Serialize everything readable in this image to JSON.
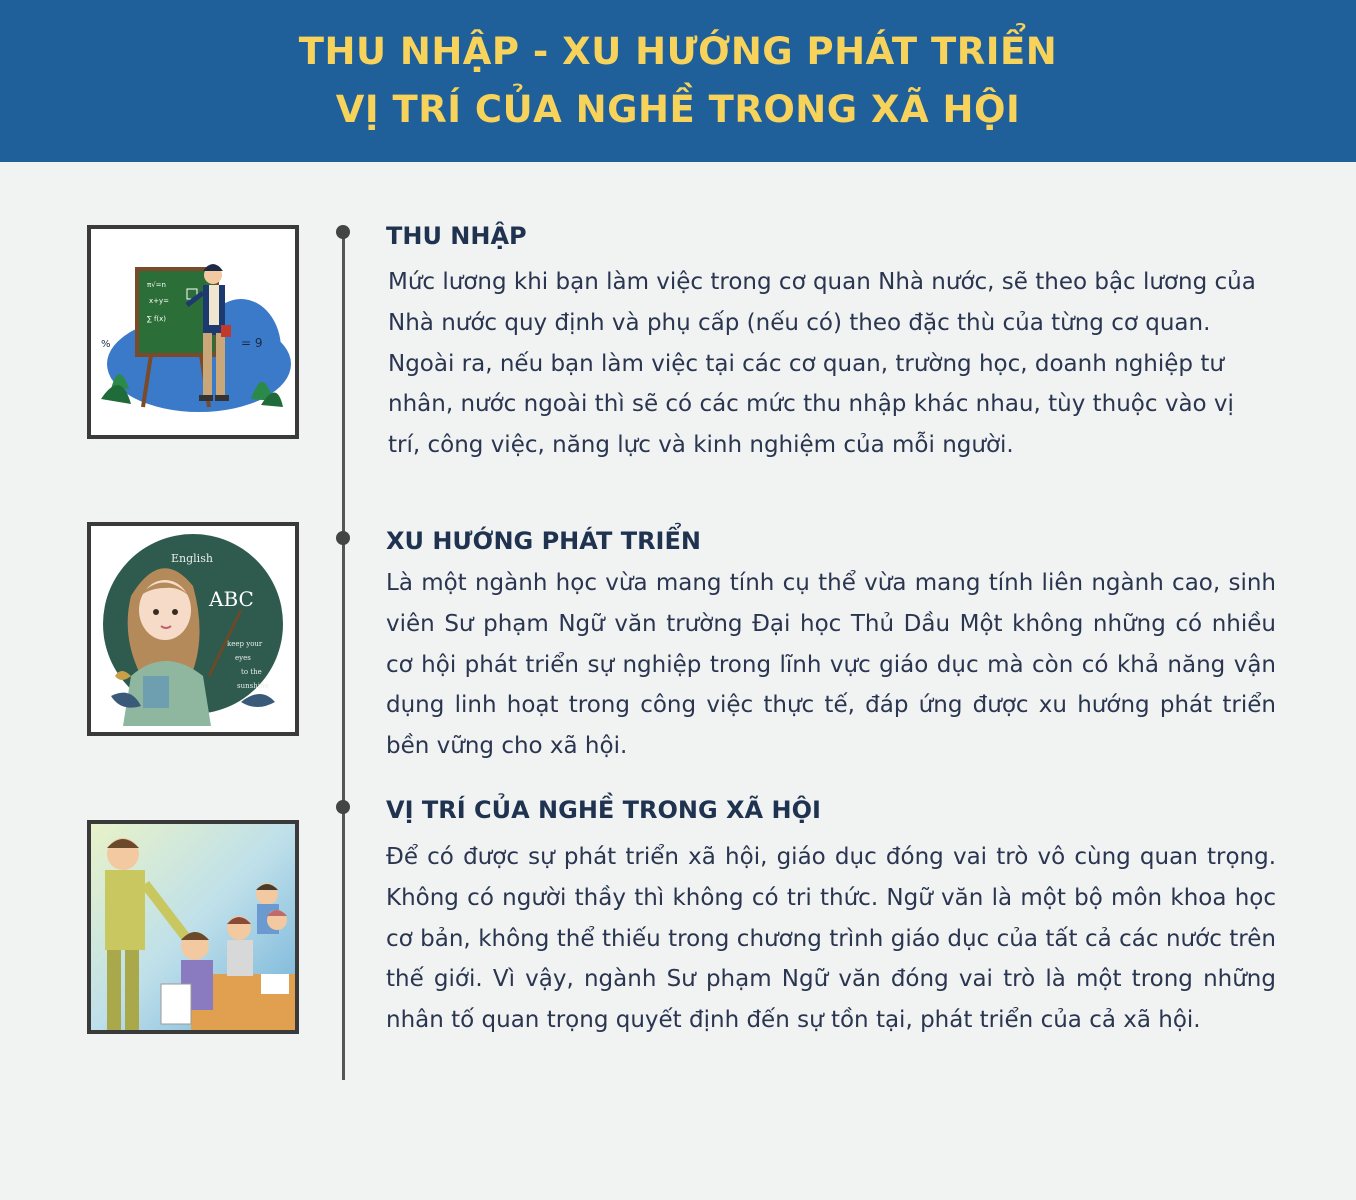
{
  "banner": {
    "title_line1": "THU NHẬP - XU HƯỚNG PHÁT TRIỂN",
    "title_line2": "VỊ TRÍ CỦA NGHỀ TRONG XÃ HỘI"
  },
  "sections": [
    {
      "title": "THU NHẬP",
      "paragraphs": [
        "Mức lương khi bạn làm việc trong cơ quan Nhà nước, sẽ theo bậc lương của Nhà nước quy định và phụ cấp (nếu có) theo đặc thù của từng cơ quan.",
        "Ngoài ra, nếu bạn làm việc tại các cơ quan, trường học, doanh nghiệp tư nhân, nước ngoài thì sẽ có các mức thu nhập khác nhau, tùy thuộc vào vị trí, công việc, năng lực và kinh nghiệm của mỗi người."
      ]
    },
    {
      "title": "XU HƯỚNG PHÁT TRIỂN",
      "paragraphs": [
        "Là một ngành học vừa mang tính cụ thể vừa mang tính liên ngành cao, sinh viên Sư phạm Ngữ văn trường Đại học Thủ Dầu Một không những có nhiều cơ hội phát triển sự nghiệp trong lĩnh vực giáo dục mà còn có khả năng vận dụng linh hoạt trong công việc thực tế, đáp ứng được xu hướng phát triển bền vững cho xã hội."
      ]
    },
    {
      "title": "VỊ TRÍ CỦA NGHỀ TRONG XÃ HỘI",
      "paragraphs": [
        "Để có được sự phát triển xã hội, giáo dục đóng vai trò vô cùng quan trọng. Không có người thầy thì không có tri thức. Ngữ văn là một bộ môn khoa học cơ bản, không thể thiếu trong chương trình giáo dục của tất cả các nước trên thế giới. Vì vậy, ngành Sư phạm Ngữ văn  đóng vai trò là một trong những nhân tố quan trọng quyết định đến sự tồn tại, phát triển của cả xã hội."
      ]
    }
  ],
  "illustrations": {
    "board_text": "English",
    "board_letters": "ABC",
    "board_phrase": "keep your eyes to the sunshine"
  }
}
